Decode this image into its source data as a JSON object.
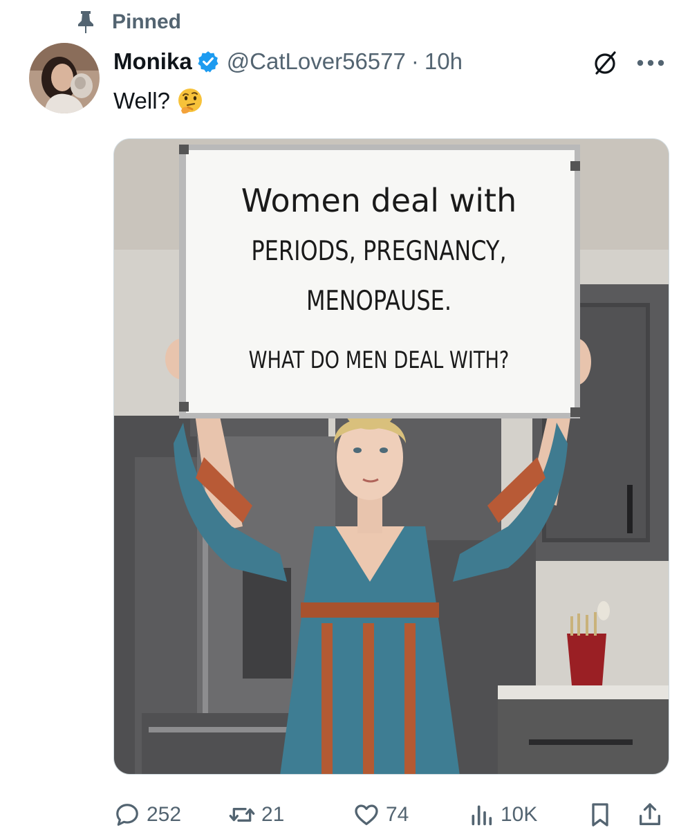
{
  "pinned": {
    "label": "Pinned",
    "icon": "pin-icon"
  },
  "author": {
    "display_name": "Monika",
    "verified": true,
    "handle": "@CatLover56577",
    "separator": "·",
    "time": "10h"
  },
  "tweet": {
    "text": "Well?",
    "emoji": "thinking-face-icon"
  },
  "media": {
    "board_lines": [
      "Women deal with",
      "PERIODS, PREGNANCY,",
      "MENOPAUSE.",
      "WHAT DO MEN DEAL WITH?"
    ]
  },
  "actions": {
    "replies": "252",
    "reposts": "21",
    "likes": "74",
    "views": "10K"
  },
  "colors": {
    "text_primary": "#0f1419",
    "text_secondary": "#536471",
    "verified_blue": "#1d9bf0",
    "border": "#cfd9de"
  }
}
